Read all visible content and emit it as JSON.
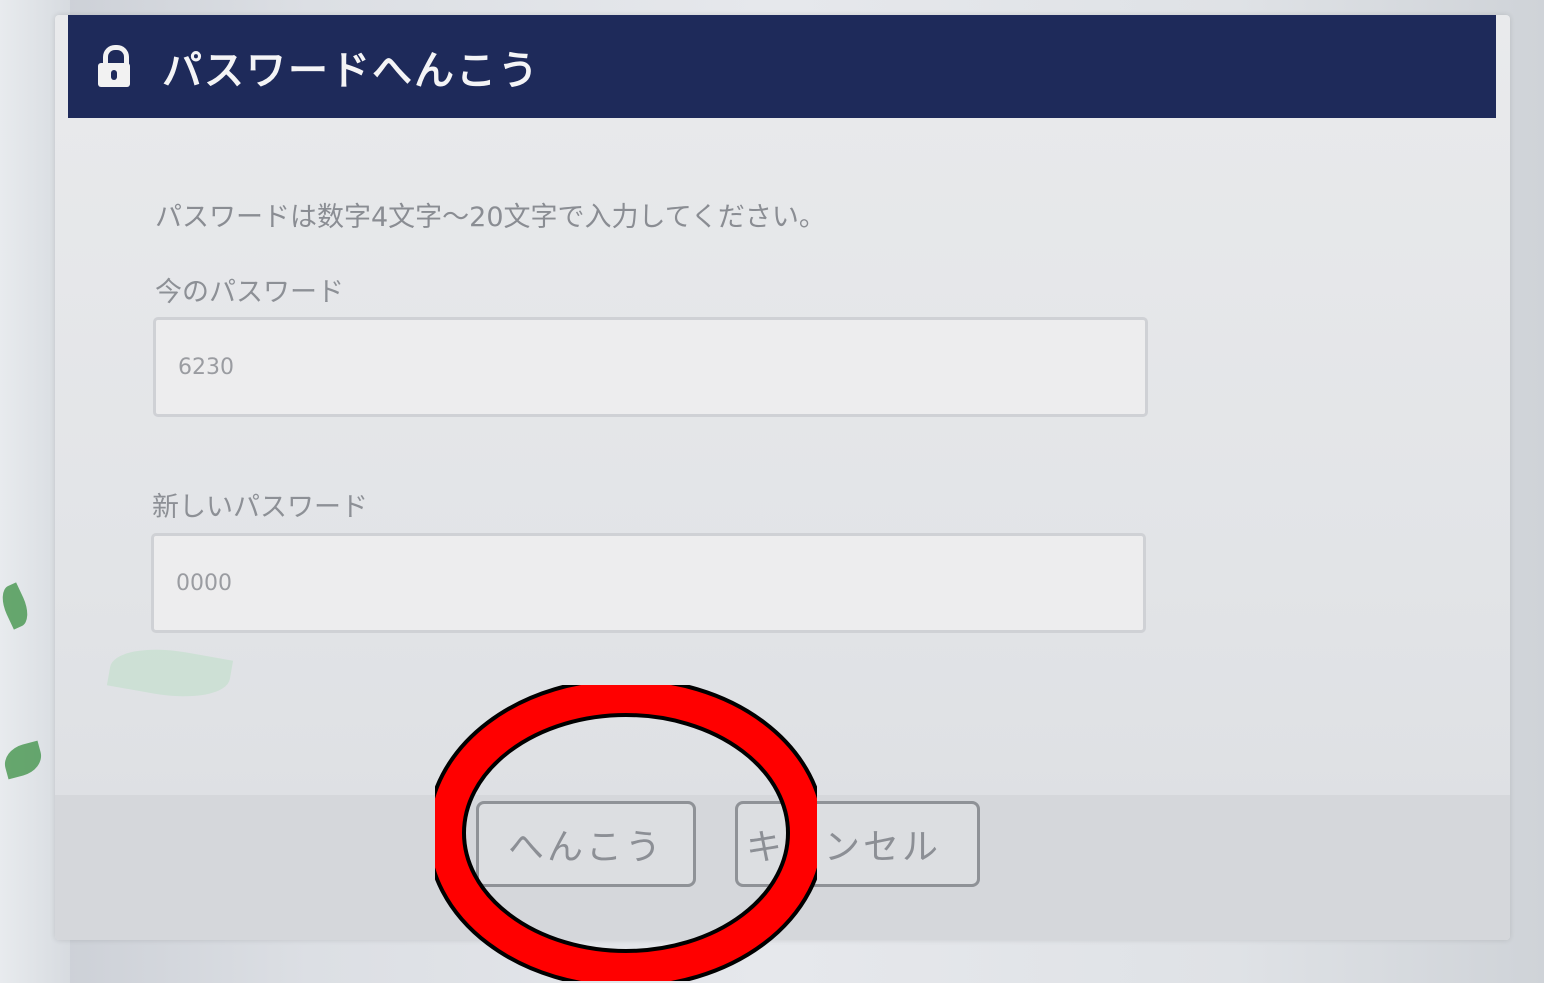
{
  "dialog": {
    "title": "パスワードへんこう",
    "instruction": "パスワードは数字4文字～20文字で入力してください。",
    "current_password": {
      "label": "今のパスワード",
      "value": "6230"
    },
    "new_password": {
      "label": "新しいパスワード",
      "value": "0000"
    },
    "buttons": {
      "change_label": "へんこう",
      "cancel_label": "キャンセル"
    }
  },
  "colors": {
    "header_bg": "#1e2a5a",
    "highlight_ring": "#ff0000"
  },
  "icons": {
    "header": "lock-icon"
  }
}
